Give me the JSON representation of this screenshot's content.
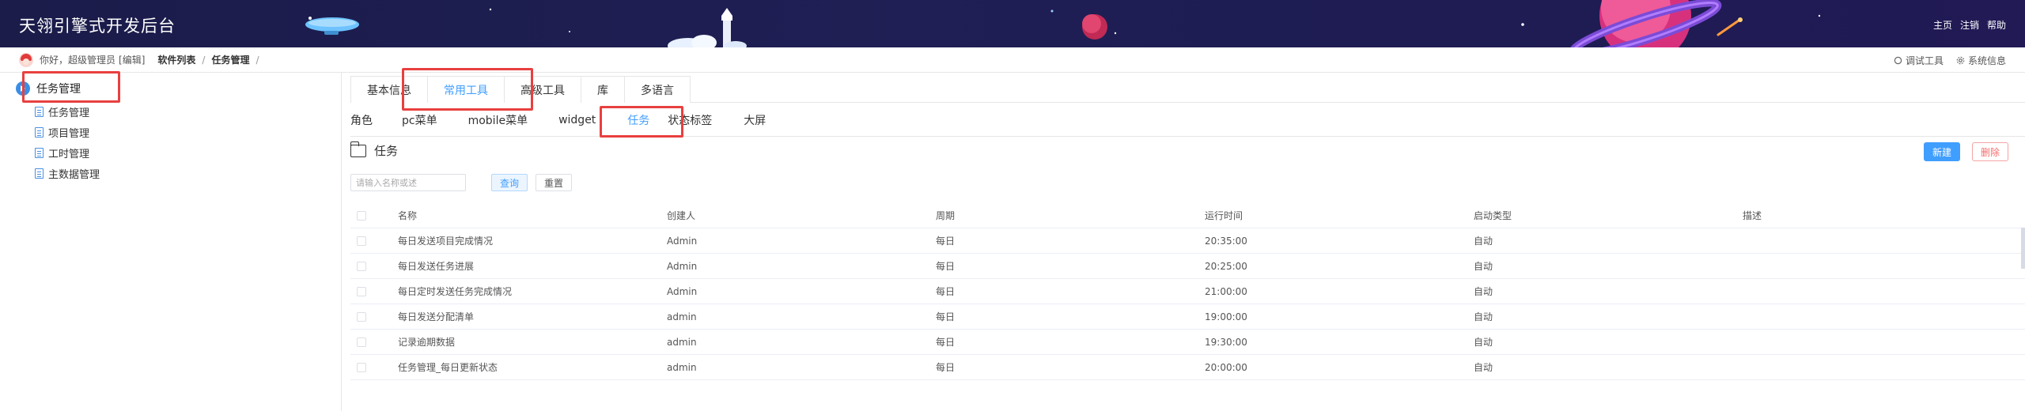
{
  "header": {
    "app_title": "天翎引擎式开发后台",
    "links": [
      "主页",
      "注销",
      "帮助"
    ]
  },
  "subbar": {
    "greeting": "你好，超级管理员",
    "edit": "[编辑]",
    "breadcrumb": [
      "软件列表",
      "任务管理"
    ],
    "separator": "/",
    "tools": [
      {
        "icon": "circle-icon",
        "label": "调试工具"
      },
      {
        "icon": "gear-icon",
        "label": "系统信息"
      }
    ]
  },
  "sidebar": {
    "root": "任务管理",
    "items": [
      "任务管理",
      "项目管理",
      "工时管理",
      "主数据管理"
    ]
  },
  "main": {
    "tabs": [
      {
        "label": "基本信息",
        "active": false
      },
      {
        "label": "常用工具",
        "active": true
      },
      {
        "label": "高级工具",
        "active": false
      },
      {
        "label": "库",
        "active": false
      },
      {
        "label": "多语言",
        "active": false
      }
    ],
    "subnav": [
      {
        "label": "角色",
        "active": false
      },
      {
        "label": "pc菜单",
        "active": false
      },
      {
        "label": "mobile菜单",
        "active": false
      },
      {
        "label": "widget",
        "active": false
      },
      {
        "label": "任务",
        "active": true
      },
      {
        "label": "状态标签",
        "active": false
      },
      {
        "label": "大屏",
        "active": false
      }
    ],
    "section_title": "任务",
    "new_button": "新建",
    "delete_button": "删除",
    "search": {
      "placeholder": "请输入名称或述",
      "value": ""
    },
    "query_button": "查询",
    "reset_button": "重置",
    "table": {
      "columns": [
        "名称",
        "创建人",
        "周期",
        "运行时间",
        "启动类型",
        "描述"
      ],
      "rows": [
        [
          "每日发送项目完成情况",
          "Admin",
          "每日",
          "20:35:00",
          "自动",
          ""
        ],
        [
          "每日发送任务进展",
          "Admin",
          "每日",
          "20:25:00",
          "自动",
          ""
        ],
        [
          "每日定时发送任务完成情况",
          "Admin",
          "每日",
          "21:00:00",
          "自动",
          ""
        ],
        [
          "每日发送分配清单",
          "admin",
          "每日",
          "19:00:00",
          "自动",
          ""
        ],
        [
          "记录逾期数据",
          "admin",
          "每日",
          "19:30:00",
          "自动",
          ""
        ],
        [
          "任务管理_每日更新状态",
          "admin",
          "每日",
          "20:00:00",
          "自动",
          ""
        ]
      ]
    }
  },
  "colors": {
    "header_bg": "#1f1f55",
    "accent": "#409eff",
    "highlight": "#e8403f",
    "danger": "#f56c6c"
  }
}
